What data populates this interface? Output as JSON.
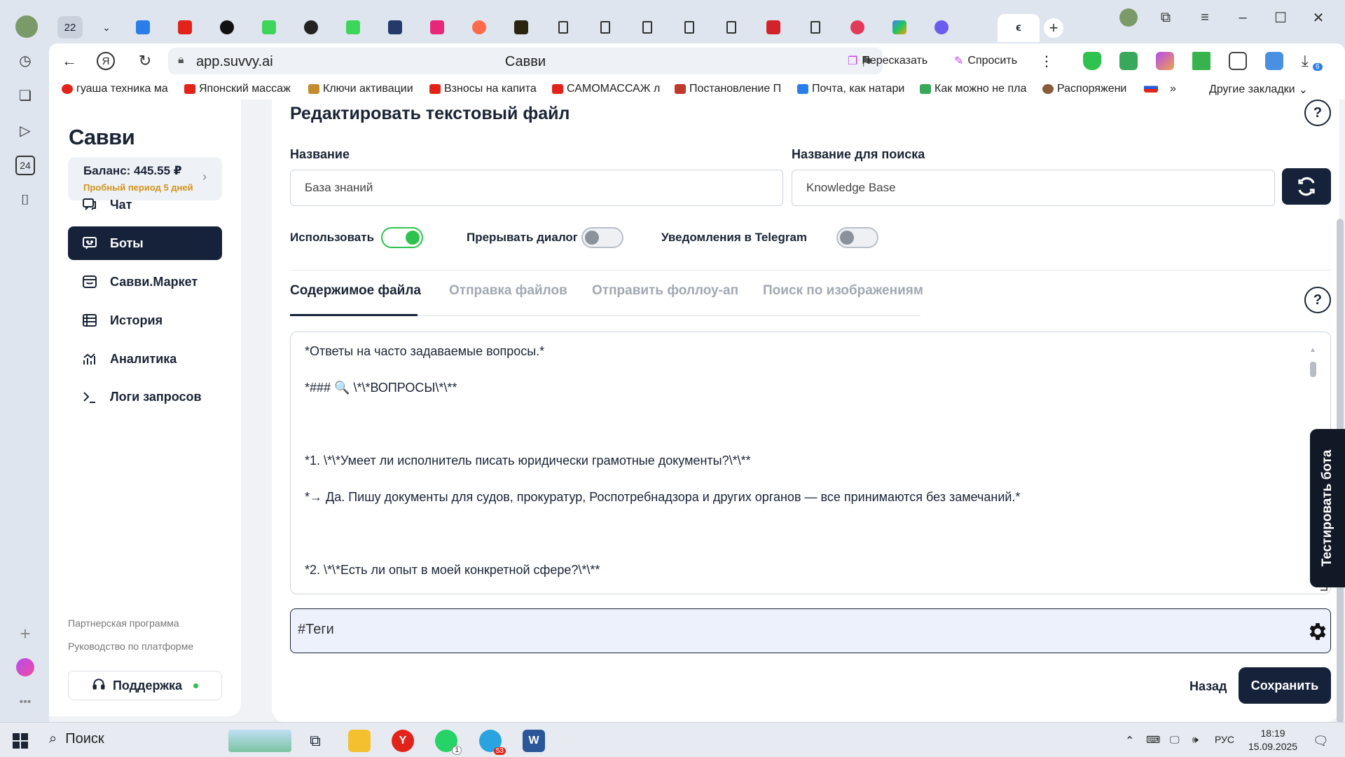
{
  "browser": {
    "tab_count": "22",
    "url": "app.suvvy.ai",
    "page_title": "Савви",
    "retell_label": "Пересказать",
    "ask_label": "Спросить",
    "downloads_badge": "6",
    "bookmarks": [
      "гуаша техника ма",
      "Японский массаж",
      "Ключи активации",
      "Взносы на капита",
      "САМОМАССАЖ л",
      "Постановление П",
      "Почта, как натари",
      "Как можно не пла",
      "Распоряжени"
    ],
    "other_bookmarks": "Другие закладки",
    "colors": {
      "chrome": "#dfe5ee",
      "accent": "#16223a",
      "green": "#2ec24f"
    }
  },
  "sidebar": {
    "logo": "Cавви",
    "balance": "Баланс: 445.55 ₽",
    "trial": "Пробный период 5 дней",
    "nav": [
      {
        "label": "Чат",
        "icon": "chat-icon"
      },
      {
        "label": "Боты",
        "icon": "bot-icon"
      },
      {
        "label": "Савви.Маркет",
        "icon": "market-icon"
      },
      {
        "label": "История",
        "icon": "history-icon"
      },
      {
        "label": "Аналитика",
        "icon": "analytics-icon"
      },
      {
        "label": "Логи запросов",
        "icon": "terminal-icon"
      }
    ],
    "partner_link": "Партнерская программа",
    "guide_link": "Руководство по платформе",
    "support": "Поддержка"
  },
  "main": {
    "title": "Редактировать текстовый файл",
    "help": "?",
    "name_label": "Название",
    "name_value": "База знаний",
    "search_label": "Название для поиска",
    "search_value": "Knowledge Base",
    "toggles": [
      {
        "label": "Использовать",
        "on": true
      },
      {
        "label": "Прерывать диалог",
        "on": false
      },
      {
        "label": "Уведомления в Telegram",
        "on": false
      }
    ],
    "tabs": [
      "Содержимое файла",
      "Отправка файлов",
      "Отправить фоллоу-ап",
      "Поиск по изображениям"
    ],
    "content_lines": [
      "*Ответы на часто задаваемые вопросы.*",
      "",
      "*### 🔍 \\*\\*ВОПРОСЫ\\*\\**",
      "",
      "",
      "",
      "*1. \\*\\*Умеет ли исполнитель писать юридически грамотные документы?\\*\\**",
      "",
      "*→ Да. Пишу документы для судов, прокуратур, Роспотребнадзора и других органов — все принимаются без замечаний.*",
      "",
      "",
      "",
      "*2. \\*\\*Есть ли опыт в моей конкретной сфере?\\*\\**"
    ],
    "tags_placeholder": "#Теги",
    "back": "Назад",
    "save": "Сохранить",
    "test_bot": "Тестировать бота"
  },
  "taskbar": {
    "search": "Поиск",
    "whatsapp_badge": "1",
    "telegram_badge": "53",
    "lang": "РУС",
    "time": "18:19",
    "date": "15.09.2025"
  }
}
